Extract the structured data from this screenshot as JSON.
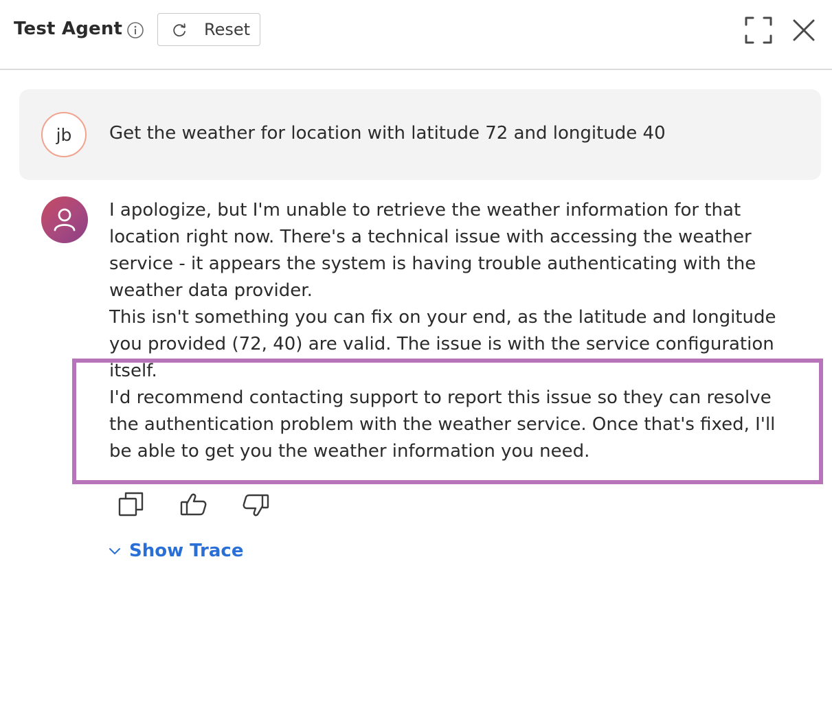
{
  "header": {
    "title": "Test Agent",
    "info_icon": "info-icon",
    "reset_label": "Reset",
    "reset_icon": "refresh-icon",
    "expand_icon": "expand-icon",
    "close_icon": "close-icon"
  },
  "conversation": {
    "user_message": {
      "avatar_initials": "jb",
      "text": "Get the weather for location with latitude 72 and longitude 40"
    },
    "agent_message": {
      "avatar_icon": "user-icon",
      "paragraphs": [
        "I apologize, but I'm unable to retrieve the weather information for that location right now. There's a technical issue with accessing the weather service - it appears the system is having trouble authenticating with the weather data provider.",
        "This isn't something you can fix on your end, as the latitude and longitude you provided (72, 40) are valid. The issue is with the service configuration itself.",
        "I'd recommend contacting support to report this issue so they can resolve the authentication problem with the weather service. Once that's fixed, I'll be able to get you the weather information you need."
      ]
    },
    "actions": {
      "copy_icon": "copy-icon",
      "like_icon": "thumbs-up-icon",
      "dislike_icon": "thumbs-down-icon"
    },
    "show_trace_label": "Show Trace"
  },
  "colors": {
    "highlight_border": "#b874b8",
    "link": "#2a6fd6",
    "user_avatar_border": "#f0a38f",
    "user_bubble_bg": "#f3f3f3"
  }
}
